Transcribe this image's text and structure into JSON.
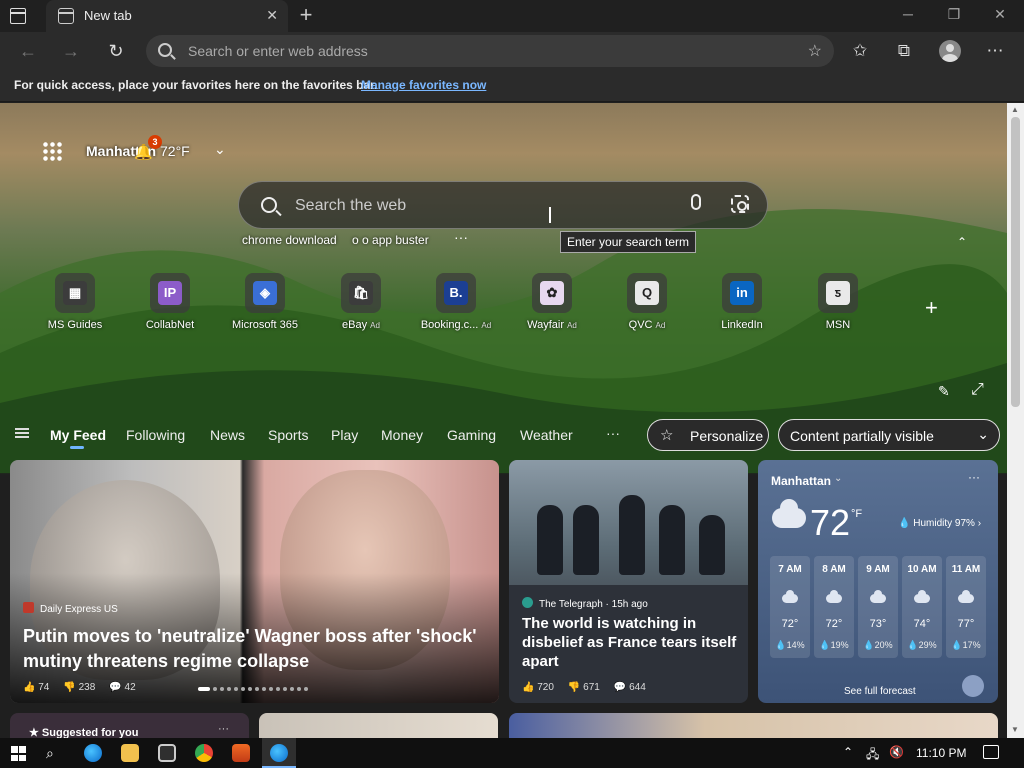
{
  "browser": {
    "tab_title": "New tab",
    "new_tab_symbol": "+",
    "close_symbol": "✕",
    "window_controls": [
      "─",
      "❐",
      "✕"
    ],
    "address_placeholder": "Search or enter web address",
    "favorites_bar": {
      "message": "For quick access, place your favorites here on the favorites bar.",
      "link": "Manage favorites now"
    }
  },
  "header": {
    "location": "Manhattan",
    "notification_count": "3",
    "weather": "72°F"
  },
  "search": {
    "placeholder": "Search the web",
    "tooltip": "Enter your search term",
    "trending": [
      "chrome download",
      "o o app buster"
    ],
    "more": "···"
  },
  "quick_links": [
    {
      "label": "MS Guides",
      "ad": "",
      "color": "#3c3c3c",
      "glyph": "▦"
    },
    {
      "label": "CollabNet",
      "ad": "",
      "color": "#8c5cc9",
      "glyph": "IP"
    },
    {
      "label": "Microsoft 365",
      "ad": "",
      "color": "#3a6fd6",
      "glyph": "◈"
    },
    {
      "label": "eBay",
      "ad": "Ad",
      "color": "#3c3c3c",
      "glyph": "🛍"
    },
    {
      "label": "Booking.c...",
      "ad": "Ad",
      "color": "#1c3f93",
      "glyph": "B."
    },
    {
      "label": "Wayfair",
      "ad": "Ad",
      "color": "#e7d8ef",
      "glyph": "✿"
    },
    {
      "label": "QVC",
      "ad": "Ad",
      "color": "#e9e9e9",
      "glyph": "Q"
    },
    {
      "label": "LinkedIn",
      "ad": "",
      "color": "#0a66c2",
      "glyph": "in"
    },
    {
      "label": "MSN",
      "ad": "",
      "color": "#e9e9e9",
      "glyph": "ƽ"
    }
  ],
  "feed_nav": {
    "tabs": [
      "My Feed",
      "Following",
      "News",
      "Sports",
      "Play",
      "Money",
      "Gaming",
      "Weather"
    ],
    "more": "···",
    "personalize": "Personalize",
    "visibility": "Content partially visible"
  },
  "cards": {
    "main": {
      "source": "Daily Express US",
      "title": "Putin moves to 'neutralize' Wagner boss after 'shock' mutiny threatens regime collapse",
      "likes": "74",
      "dislikes": "238",
      "comments": "42"
    },
    "second": {
      "source": "The Telegraph · 15h ago",
      "title": "The world is watching in disbelief as France tears itself apart",
      "likes": "720",
      "dislikes": "671",
      "comments": "644"
    },
    "suggested": "Suggested for you"
  },
  "weather_card": {
    "location": "Manhattan",
    "temp": "72",
    "unit": "°F",
    "humidity": "Humidity 97%",
    "hours": [
      {
        "time": "7 AM",
        "temp": "72°",
        "precip": "14%"
      },
      {
        "time": "8 AM",
        "temp": "72°",
        "precip": "19%"
      },
      {
        "time": "9 AM",
        "temp": "73°",
        "precip": "20%"
      },
      {
        "time": "10 AM",
        "temp": "74°",
        "precip": "29%"
      },
      {
        "time": "11 AM",
        "temp": "77°",
        "precip": "17%"
      }
    ],
    "forecast_link": "See full forecast"
  },
  "taskbar": {
    "clock": "11:10 PM"
  }
}
